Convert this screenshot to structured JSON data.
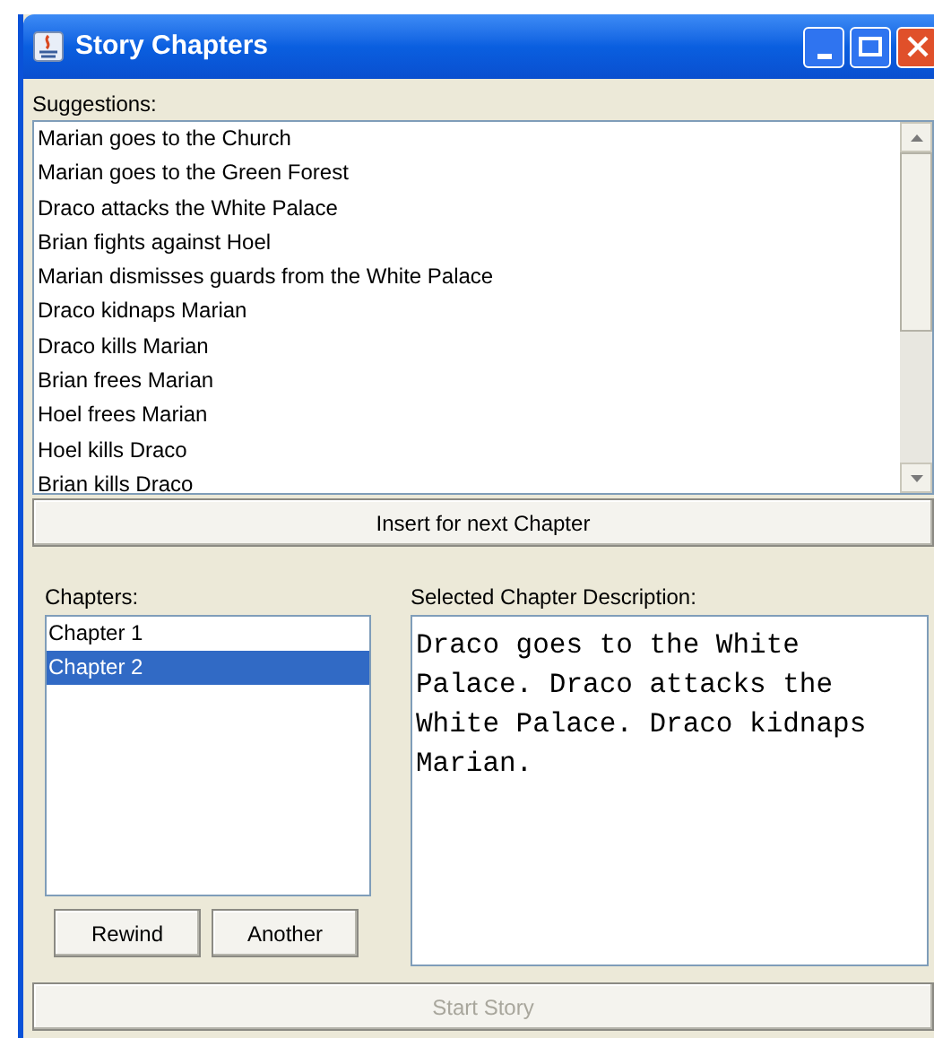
{
  "window": {
    "title": "Story Chapters"
  },
  "suggestions": {
    "label": "Suggestions:",
    "items": [
      "Marian goes to the Church",
      "Marian goes to the Green Forest",
      "Draco attacks the White Palace",
      "Brian fights against Hoel",
      "Marian dismisses guards from the White Palace",
      "Draco kidnaps Marian",
      "Draco kills Marian",
      "Brian frees Marian",
      "Hoel frees Marian",
      "Hoel kills Draco",
      "Brian kills Draco"
    ],
    "button": "Insert for next Chapter"
  },
  "chapters": {
    "label": "Chapters:",
    "items": [
      {
        "label": "Chapter 1",
        "selected": false
      },
      {
        "label": "Chapter 2",
        "selected": true
      }
    ],
    "buttons": [
      "Rewind",
      "Another"
    ]
  },
  "description": {
    "label": "Selected Chapter Description:",
    "value": "Draco goes to the White Palace. Draco attacks the White Palace. Draco kidnaps Marian."
  },
  "start_button": {
    "label": "Start Story",
    "disabled": true
  }
}
